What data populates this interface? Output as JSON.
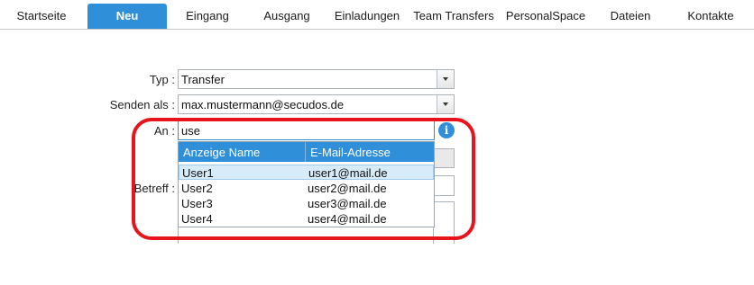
{
  "tabs": [
    {
      "label": "Startseite",
      "active": false
    },
    {
      "label": "Neu",
      "active": true
    },
    {
      "label": "Eingang",
      "active": false
    },
    {
      "label": "Ausgang",
      "active": false
    },
    {
      "label": "Einladungen",
      "active": false
    },
    {
      "label": "Team Transfers",
      "active": false
    },
    {
      "label": "PersonalSpace",
      "active": false
    },
    {
      "label": "Dateien",
      "active": false
    },
    {
      "label": "Kontakte",
      "active": false
    }
  ],
  "form": {
    "type_label": "Typ :",
    "type_value": "Transfer",
    "send_as_label": "Senden als :",
    "send_as_value": "max.mustermann@secudos.de",
    "to_label": "An :",
    "to_value": "use",
    "subject_label": "Betreff :"
  },
  "autocomplete": {
    "columns": [
      "Anzeige Name",
      "E-Mail-Adresse"
    ],
    "rows": [
      {
        "name": "User1",
        "email": "user1@mail.de",
        "selected": true
      },
      {
        "name": "User2",
        "email": "user2@mail.de",
        "selected": false
      },
      {
        "name": "User3",
        "email": "user3@mail.de",
        "selected": false
      },
      {
        "name": "User4",
        "email": "user4@mail.de",
        "selected": false
      }
    ]
  },
  "icons": {
    "info": "i"
  },
  "colors": {
    "accent": "#2f8fd8",
    "highlight": "#e8141c"
  }
}
